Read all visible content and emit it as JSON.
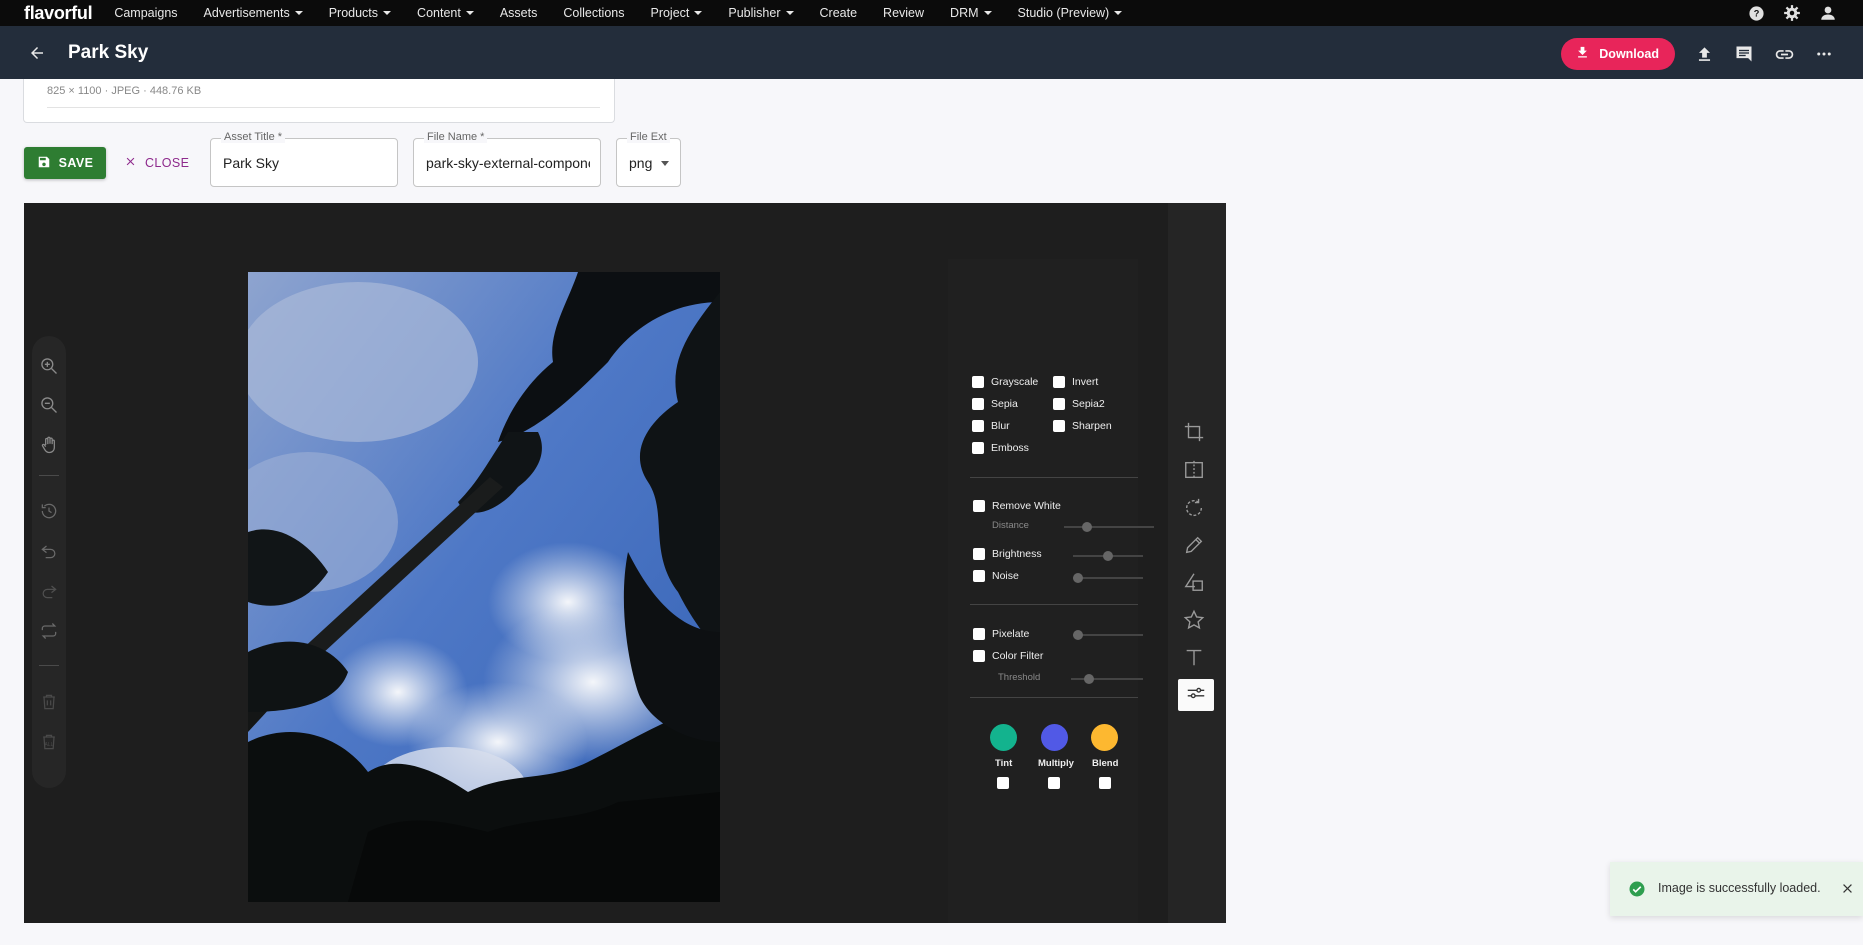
{
  "app": {
    "logo": "flavorful"
  },
  "nav": {
    "items": [
      {
        "label": "Campaigns",
        "dropdown": false
      },
      {
        "label": "Advertisements",
        "dropdown": true
      },
      {
        "label": "Products",
        "dropdown": true
      },
      {
        "label": "Content",
        "dropdown": true
      },
      {
        "label": "Assets",
        "dropdown": false
      },
      {
        "label": "Collections",
        "dropdown": false
      },
      {
        "label": "Project",
        "dropdown": true
      },
      {
        "label": "Publisher",
        "dropdown": true
      },
      {
        "label": "Create",
        "dropdown": false
      },
      {
        "label": "Review",
        "dropdown": false
      },
      {
        "label": "DRM",
        "dropdown": true
      },
      {
        "label": "Studio (Preview)",
        "dropdown": true
      }
    ],
    "right_icons": [
      "help-icon",
      "settings-gear-icon",
      "user-account-icon"
    ]
  },
  "header": {
    "title": "Park Sky",
    "download_label": "Download",
    "action_icons": [
      "upload-icon",
      "comment-icon",
      "link-icon",
      "more-options-icon"
    ]
  },
  "asset_info": {
    "meta": "825 × 1100 · JPEG · 448.76 KB"
  },
  "form": {
    "save_label": "SAVE",
    "close_label": "CLOSE",
    "asset_title": {
      "label": "Asset Title *",
      "value": "Park Sky"
    },
    "file_name": {
      "label": "File Name *",
      "value": "park-sky-external-component"
    },
    "file_ext": {
      "label": "File Ext",
      "value": "png"
    }
  },
  "editor": {
    "left_tools": [
      "zoom-in-icon",
      "zoom-out-icon",
      "pan-hand-icon",
      "history-icon",
      "undo-icon",
      "redo-icon",
      "reset-icon",
      "delete-icon",
      "delete-all-icon"
    ],
    "right_tools": [
      "crop-icon",
      "flip-icon",
      "rotate-icon",
      "draw-icon",
      "shape-icon",
      "icon-star-icon",
      "text-icon",
      "filter-icon"
    ],
    "filters": {
      "basic": [
        "Grayscale",
        "Invert",
        "Sepia",
        "Sepia2",
        "Blur",
        "Sharpen",
        "Emboss"
      ],
      "remove_white": "Remove White",
      "distance": "Distance",
      "brightness": "Brightness",
      "noise": "Noise",
      "pixelate": "Pixelate",
      "color_filter": "Color Filter",
      "threshold": "Threshold",
      "swatches": [
        {
          "label": "Tint",
          "color": "#13b38e"
        },
        {
          "label": "Multiply",
          "color": "#5159e6"
        },
        {
          "label": "Blend",
          "color": "#fdb830"
        }
      ]
    }
  },
  "toast": {
    "message": "Image is successfully loaded.",
    "accent": "#2e9e4f"
  }
}
